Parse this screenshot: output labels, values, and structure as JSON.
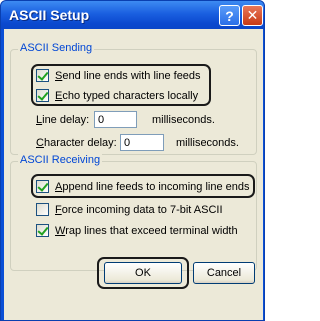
{
  "window": {
    "title": "ASCII Setup"
  },
  "titlebar": {
    "help_glyph": "?",
    "close_glyph": "✕"
  },
  "sending": {
    "legend": "ASCII Sending",
    "send_line_ends": {
      "label_u": "S",
      "label_rest": "end line ends with line feeds",
      "checked": true
    },
    "echo_typed": {
      "label_u": "E",
      "label_rest": "cho typed characters locally",
      "checked": true
    },
    "line_delay": {
      "label_u": "L",
      "label_rest": "ine delay:",
      "value": "0",
      "unit": "milliseconds."
    },
    "char_delay": {
      "label_u": "C",
      "label_rest": "haracter delay:",
      "value": "0",
      "unit": "milliseconds."
    }
  },
  "receiving": {
    "legend": "ASCII Receiving",
    "append_line_feeds": {
      "label_u": "A",
      "label_rest": "ppend line feeds to incoming line ends",
      "checked": true
    },
    "force_7bit": {
      "label_u": "F",
      "label_rest": "orce incoming data to 7-bit ASCII",
      "checked": false
    },
    "wrap_lines": {
      "label_u": "W",
      "label_rest": "rap lines that exceed terminal width",
      "checked": true
    }
  },
  "buttons": {
    "ok": "OK",
    "cancel": "Cancel"
  },
  "colors": {
    "title_bar": "#0a4fd6",
    "dialog_face": "#ece9d8",
    "group_legend": "#0046d5",
    "close": "#c83a14"
  }
}
